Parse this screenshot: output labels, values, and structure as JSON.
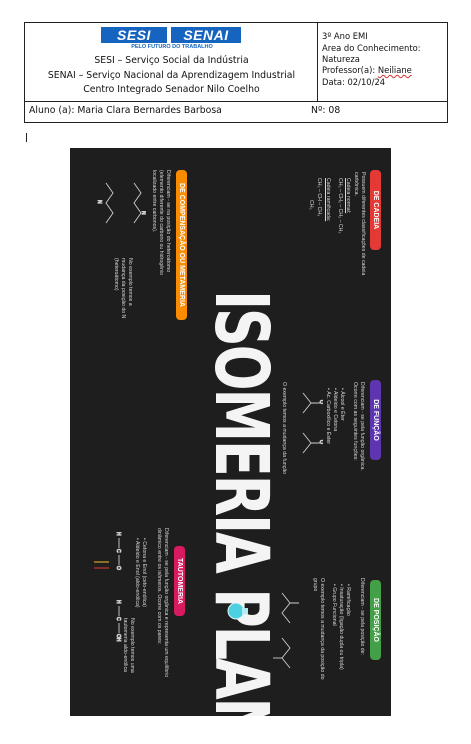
{
  "header": {
    "logo": {
      "left_word": "SESI",
      "right_word": "SENAI",
      "tagline": "PELO FUTURO DO TRABALHO"
    },
    "line1": "SESI – Serviço Social da Indústria",
    "line2": "SENAI – Serviço Nacional da Aprendizagem Industrial",
    "line3": "Centro Integrado Senador Nilo Coelho",
    "grade": "3º Ano EMI",
    "area_label": "Area do Conhecimento:",
    "area_value": "Natureza",
    "teacher_label": "Professor(a): ",
    "teacher_value": "Neiliane",
    "date": "Data: 02/10/24",
    "student": "Aluno (a): Maria Clara Bernardes Barbosa",
    "number": "Nº: 08"
  },
  "poster": {
    "title": "ISOMERIA PLANA",
    "colors": {
      "bg": "#1e1e1e",
      "cadeia": "#e53935",
      "compensacao": "#fb8c00",
      "funcao": "#5e35b1",
      "tautomeria": "#d81b60",
      "posicao": "#43a047"
    },
    "sections": {
      "cadeia": {
        "label": "DE CADEIA",
        "text": "Possuem diferentes classificações de cadeia carbônica.",
        "sub1": "Cadeia normal:",
        "f1": "CH₃ – CH₂ – CH₂ – CH₃",
        "sub2": "Cadeia ramificada:",
        "f2": "CH₃ – CH – CH₃",
        "f2b": "CH₃"
      },
      "compensacao": {
        "label": "DE COMPENSAÇÃO OU METAMERIA",
        "text1": "Diferenciam - se na posição do heteroátomo",
        "text2": "(elemento diferente do carbono ou hidrogênio",
        "text3": "localizado entre carbonos).",
        "note": "No exemplo temos a mudança da posição do N (heteroátomo)",
        "atom": "N"
      },
      "funcao": {
        "label": "DE FUNÇÃO",
        "text": "Diferenciam - se pela função orgânica. Ocorre com as seguintes funções:",
        "items": [
          "Álcool e Éter",
          "Aldeído e Cetona",
          "Ác. Carboxílico e Éster"
        ],
        "note": "O exemplo temos a mudança da função",
        "atom": "O"
      },
      "tautomeria": {
        "label": "TAUTOMERIA",
        "text": "Diferenciam - se pela função orgânica e representa um equilíbrio dinâmico entre os isômeros. Ocorre com os pares:",
        "items": [
          "Cetona e Enol (ceto-enólica)",
          "Aldeído e Enol (aldo-enólica)"
        ],
        "note": "No exemplo temos uma tautomeria aldo-enólica",
        "atoms": [
          "H",
          "C",
          "O",
          "OH"
        ]
      },
      "posicao": {
        "label": "DE POSIÇÃO",
        "text": "Diferenciam - se pela posição de:",
        "items": [
          "Ramificação",
          "Insaturação (ligação dupla ou tripla)",
          "Grupo Funcional"
        ],
        "note": "O exemplo temos a mudança da posição do grupo"
      }
    }
  }
}
